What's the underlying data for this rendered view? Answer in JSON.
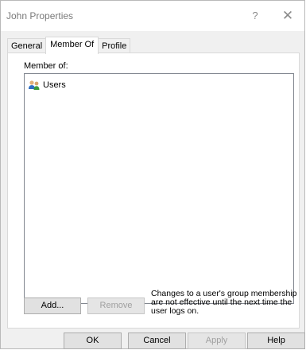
{
  "window": {
    "title": "John Properties",
    "help_glyph": "?",
    "close_glyph": "✕"
  },
  "tabs": [
    {
      "label": "General",
      "active": false
    },
    {
      "label": "Member Of",
      "active": true
    },
    {
      "label": "Profile",
      "active": false
    }
  ],
  "member_of": {
    "label": "Member of:",
    "groups": [
      {
        "name": "Users",
        "icon": "group-icon"
      }
    ]
  },
  "panel_buttons": {
    "add": "Add...",
    "remove": "Remove",
    "remove_enabled": false
  },
  "note": "Changes to a user's group membership are not effective until the next time the user logs on.",
  "dialog_buttons": {
    "ok": "OK",
    "cancel": "Cancel",
    "apply": "Apply",
    "apply_enabled": false,
    "help": "Help"
  },
  "colors": {
    "accent_icon_blue": "#2f6fc4",
    "accent_icon_green": "#3c9a3c",
    "disabled_text": "#a0a0a0"
  }
}
